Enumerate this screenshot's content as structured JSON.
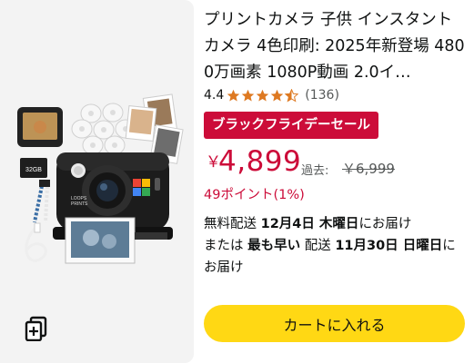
{
  "product": {
    "title": "プリントカメラ 子供 インスタントカメラ 4色印刷: 2025年新登場 4800万画素 1080P動画 2.0イ…",
    "rating_value": "4.4",
    "rating": 4.4,
    "review_count": "(136)",
    "sale_badge": "ブラックフライデーセール",
    "price_symbol": "￥",
    "price_value": "4,899",
    "past_label": "過去:",
    "past_price": "￥6,999",
    "points": "49ポイント(1%)",
    "delivery": {
      "line1_prefix": "無料配送 ",
      "line1_date": "12月4日 木曜日",
      "line1_suffix": "にお届け",
      "line2_prefix": "または ",
      "line2_fastest": "最も早い",
      "line2_mid": " 配送 ",
      "line2_date": "11月30日 日曜日",
      "line2_suffix": "にお届け"
    },
    "add_to_cart_label": "カートに入れる",
    "image": {
      "sd_card_label": "32GB",
      "camera_brand": "LOOPS PRINTS"
    }
  },
  "colors": {
    "price_red": "#cc0c39",
    "badge_red": "#cc0c39",
    "star_orange": "#de7921",
    "cart_yellow": "#ffd814",
    "secondary_text": "#565959"
  },
  "icons": {
    "compare": "compare-icon",
    "star": "star-icon"
  }
}
